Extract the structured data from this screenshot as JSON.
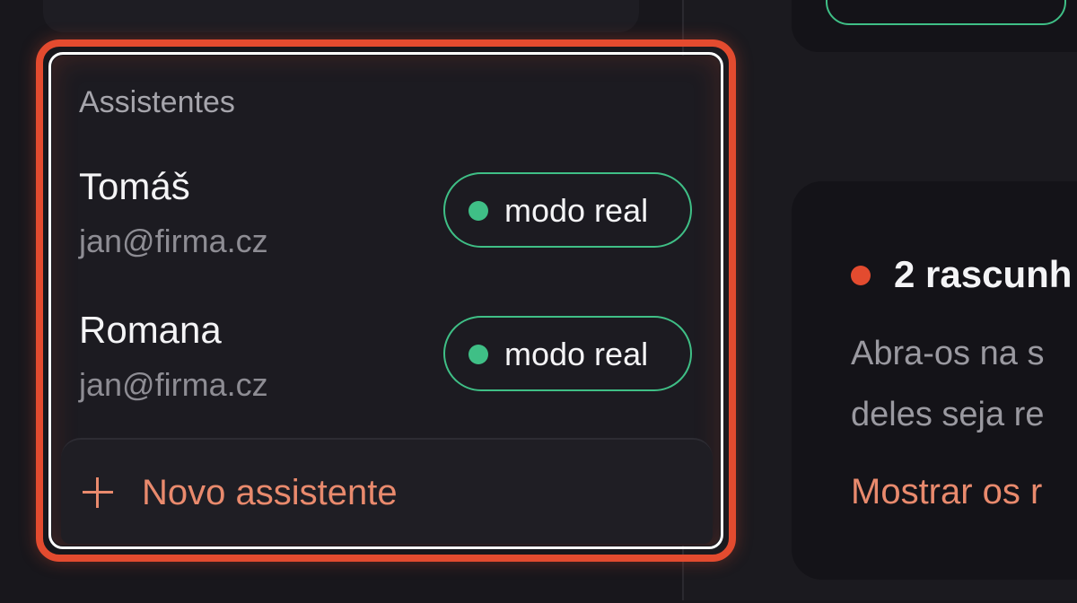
{
  "assistants": {
    "title": "Assistentes",
    "items": [
      {
        "name": "Tomáš",
        "email": "jan@firma.cz",
        "mode_label": "modo real"
      },
      {
        "name": "Romana",
        "email": "jan@firma.cz",
        "mode_label": "modo real"
      }
    ],
    "new_label": "Novo assistente"
  },
  "drafts": {
    "title": "2 rascunh",
    "body_line1": "Abra-os na s",
    "body_line2": "deles seja re",
    "link_label": "Mostrar os r"
  },
  "colors": {
    "highlight": "#e34b2f",
    "live_mode": "#3fbf86",
    "accent_link": "#e98a6d",
    "drafts_dot": "#e34b2f"
  },
  "icons": {
    "mode_status": "green-dot-icon",
    "new_assistant": "plus-icon",
    "drafts_status": "red-dot-icon"
  }
}
